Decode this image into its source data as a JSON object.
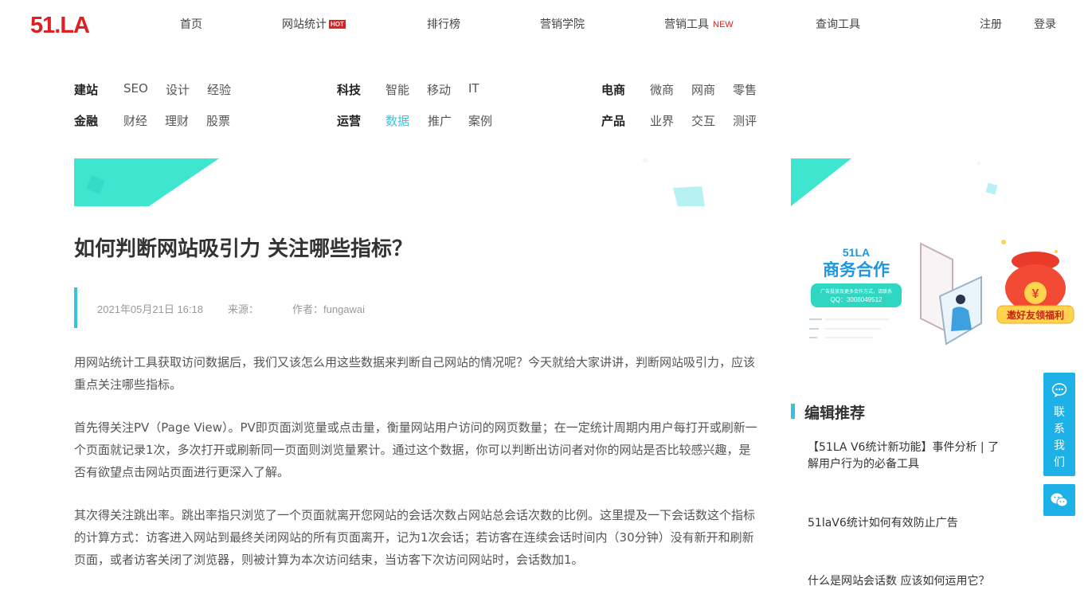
{
  "header": {
    "logo": "51.LA",
    "nav": [
      {
        "label": "首页"
      },
      {
        "label": "网站统计",
        "badge": "HOT"
      },
      {
        "label": "排行榜"
      },
      {
        "label": "营销学院"
      },
      {
        "label": "营销工具",
        "badge": "NEW"
      },
      {
        "label": "查询工具"
      }
    ],
    "register": "注册",
    "login": "登录"
  },
  "categories": [
    {
      "name": "建站",
      "subs": [
        "SEO",
        "设计",
        "经验"
      ]
    },
    {
      "name": "科技",
      "subs": [
        "智能",
        "移动",
        "IT"
      ]
    },
    {
      "name": "电商",
      "subs": [
        "微商",
        "网商",
        "零售"
      ]
    },
    {
      "name": "金融",
      "subs": [
        "财经",
        "理财",
        "股票"
      ]
    },
    {
      "name": "运营",
      "subs": [
        "数据",
        "推广",
        "案例"
      ],
      "active": "数据"
    },
    {
      "name": "产品",
      "subs": [
        "业界",
        "交互",
        "测评"
      ]
    }
  ],
  "article": {
    "title": "如何判断网站吸引力 关注哪些指标？",
    "date": "2021年05月21日 16:18",
    "source_label": "来源：",
    "author": "作者：fungawai",
    "paragraphs": [
      "用网站统计工具获取访问数据后，我们又该怎么用这些数据来判断自己网站的情况呢？今天就给大家讲讲，判断网站吸引力，应该重点关注哪些指标。",
      "首先得关注PV（Page View）。PV即页面浏览量或点击量，衡量网站用户访问的网页数量；在一定统计周期内用户每打开或刷新一个页面就记录1次，多次打开或刷新同一页面则浏览量累计。通过这个数据，你可以判断出访问者对你的网站是否比较感兴趣，是否有欲望点击网站页面进行更深入了解。",
      "其次得关注跳出率。跳出率指只浏览了一个页面就离开您网站的会话次数占网站总会话次数的比例。这里提及一下会话数这个指标的计算方式：访客进入网站到最终关闭网站的所有页面离开，记为1次会话；若访客在连续会话时间内（30分钟）没有新开和刷新页面，或者访客关闭了浏览器，则被计算为本次访问结束，当访客下次访问网站时，会话数加1。"
    ]
  },
  "sidebar": {
    "ad": {
      "brand": "51LA",
      "title": "商务合作",
      "desc": "广告投放及更多合作方式，请联系",
      "qq": "QQ：3008049512",
      "bag_label": "邀好友领福利"
    },
    "recommend_title": "编辑推荐",
    "recommend": [
      {
        "title": "【51LA V6统计新功能】事件分析 | 了解用户行为的必备工具"
      },
      {
        "title": "51laV6统计如何有效防止广告"
      },
      {
        "title": "什么是网站会话数 应该如何运用它？"
      }
    ]
  },
  "float": {
    "contact": [
      "联",
      "系",
      "我",
      "们"
    ]
  },
  "colors": {
    "accent": "#37c3e0",
    "brand_red": "#e02020",
    "float_bg": "#1eb1e8"
  }
}
